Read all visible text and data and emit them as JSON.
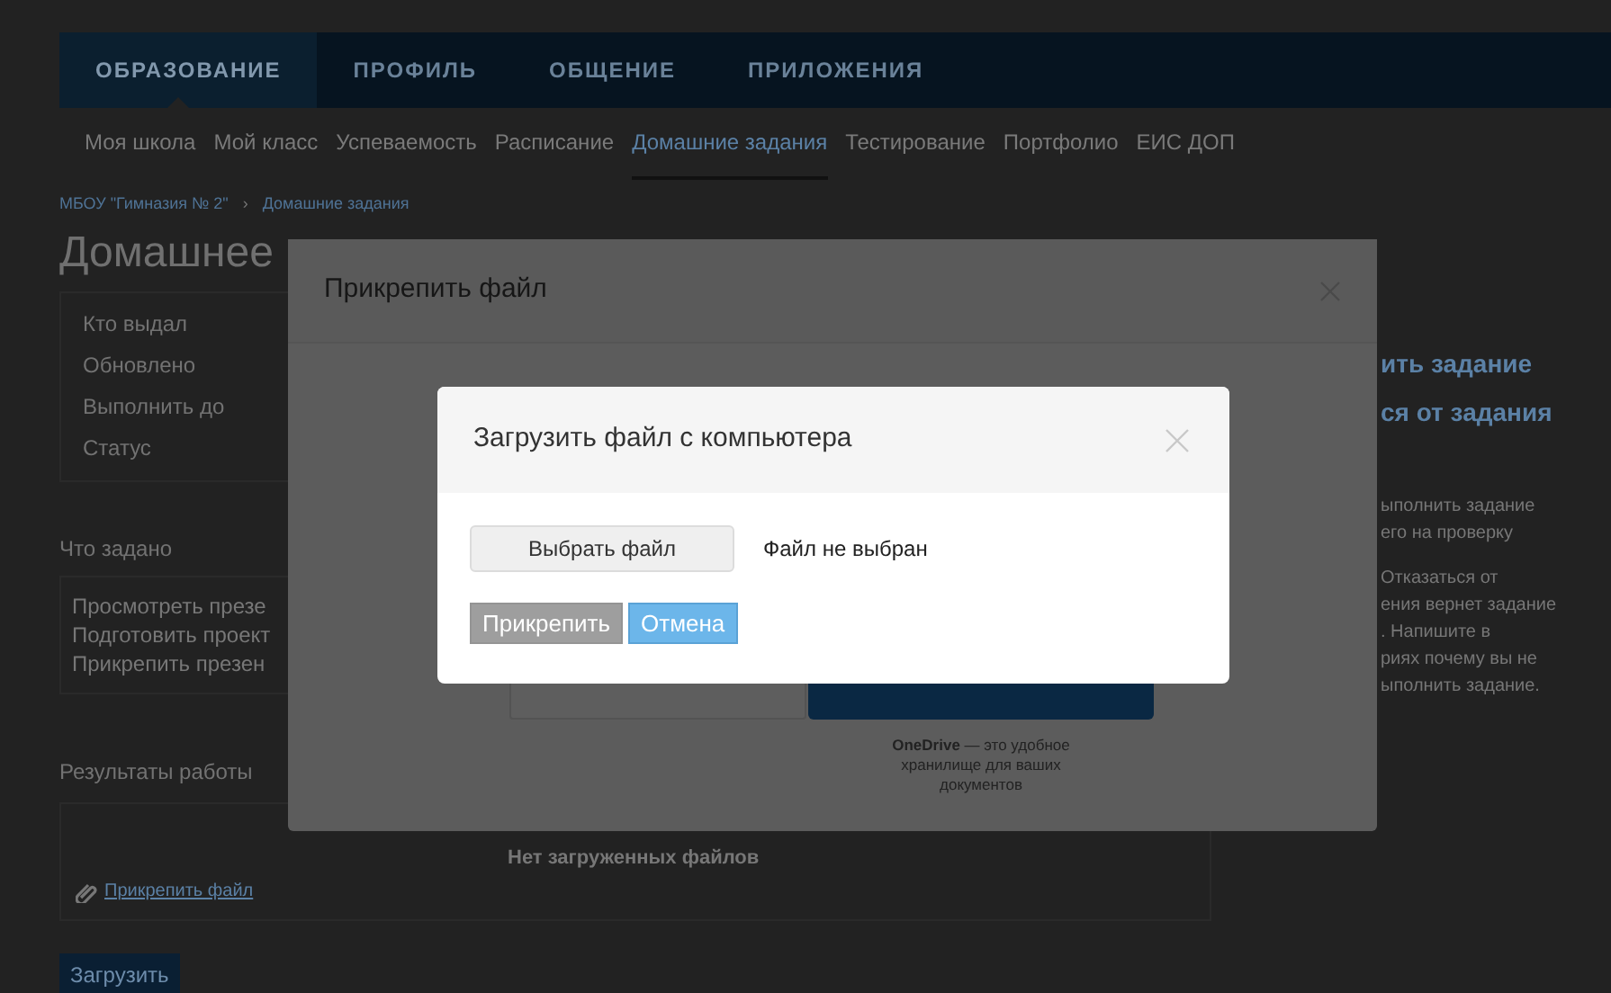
{
  "top_nav": [
    {
      "label": "ОБРАЗОВАНИЕ",
      "selected": true
    },
    {
      "label": "ПРОФИЛЬ",
      "selected": false
    },
    {
      "label": "ОБЩЕНИЕ",
      "selected": false
    },
    {
      "label": "ПРИЛОЖЕНИЯ",
      "selected": false
    }
  ],
  "sub_nav": [
    {
      "label": "Моя школа",
      "selected": false
    },
    {
      "label": "Мой класс",
      "selected": false
    },
    {
      "label": "Успеваемость",
      "selected": false
    },
    {
      "label": "Расписание",
      "selected": false
    },
    {
      "label": "Домашние задания",
      "selected": true
    },
    {
      "label": "Тестирование",
      "selected": false
    },
    {
      "label": "Портфолио",
      "selected": false
    },
    {
      "label": "ЕИС ДОП",
      "selected": false
    }
  ],
  "breadcrumb": [
    "МБОУ \"Гимназия № 2\"",
    "Домашние задания"
  ],
  "breadcrumb_separator": "›",
  "page_title": "Домашнее",
  "info_labels": [
    "Кто выдал",
    "Обновлено",
    "Выполнить до",
    "Статус"
  ],
  "task_heading": "Что задано",
  "tasks": [
    "Просмотреть презе",
    "Подготовить проект",
    "Прикрепить презен"
  ],
  "results_heading": "Результаты работы",
  "attach_link": "Прикрепить файл",
  "no_files": "Нет загруженных файлов",
  "upload_button": "Загрузить",
  "side_actions": [
    "ить задание",
    "ся от задания"
  ],
  "side_notes": [
    [
      "ыполнить задание",
      "его на проверку"
    ],
    [
      "Отказаться от",
      "ения вернет задание",
      ". Напишите в",
      "риях почему вы не",
      "ыполнить задание."
    ]
  ],
  "attach_dialog": {
    "title": "Прикрепить файл",
    "onedrive_caption": "**OneDrive** — это удобное хранилище для ваших документов"
  },
  "upload_dialog": {
    "title": "Загрузить файл с компьютера",
    "choose_button": "Выбрать файл",
    "file_status": "Файл не выбран",
    "attach_button": {
      "label": "Прикрепить",
      "disabled": true
    },
    "cancel_button": "Отмена"
  }
}
